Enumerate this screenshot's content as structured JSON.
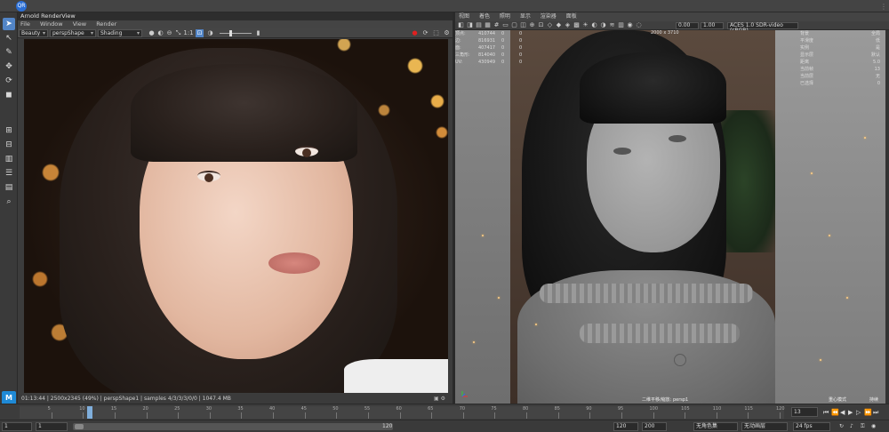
{
  "topbar": {
    "badge": "QR"
  },
  "render_view": {
    "title": "Arnold RenderView",
    "menu": [
      "File",
      "Window",
      "View",
      "Render"
    ],
    "aov_select": "Beauty",
    "camera_select": "perspShape",
    "shading_select": "Shading",
    "zoom_label": "1:1",
    "status": "01:13:44  |  2500x2345 (49%)  |  perspShape1  |  samples 4/3/3/3/0/0  |  1047.4 MB"
  },
  "viewport": {
    "menu": [
      "视图",
      "着色",
      "照明",
      "显示",
      "渲染器",
      "面板"
    ],
    "gamma_value": "0.00",
    "exposure_value": "1.00",
    "color_space": "ACES 1.0 SDR-video (sRGB)",
    "resolution": "2000 x 3710",
    "hud_left": [
      [
        "顶点:",
        "410744",
        "0",
        "0"
      ],
      [
        "边:",
        "816931",
        "0",
        "0"
      ],
      [
        "面:",
        "407417",
        "0",
        "0"
      ],
      [
        "三角形:",
        "814040",
        "0",
        "0"
      ],
      [
        "UV:",
        "430949",
        "0",
        "0"
      ]
    ],
    "hud_right": [
      [
        "背景",
        "全局"
      ],
      [
        "平滑度",
        "低"
      ],
      [
        "实例",
        "是"
      ],
      [
        "显示层",
        "默认"
      ],
      [
        "距离",
        "5.0"
      ],
      [
        "当前帧",
        "13"
      ],
      [
        "当前层",
        "无"
      ],
      [
        "已选择",
        "0"
      ]
    ],
    "camera_label": "二维平移/缩放: persp1",
    "corner_left": "重心模式",
    "corner_right": "持续"
  },
  "timeline": {
    "current_frame": "13",
    "tick_labels": [
      "5",
      "10",
      "15",
      "20",
      "25",
      "30",
      "35",
      "40",
      "45",
      "50",
      "55",
      "60",
      "65",
      "70",
      "75",
      "80",
      "85",
      "90",
      "95",
      "100",
      "105",
      "110",
      "115",
      "120"
    ]
  },
  "range": {
    "start": "1",
    "inner_start": "1",
    "inner_end": "120",
    "end_a": "120",
    "end_b": "200",
    "no_char_set": "无角色集",
    "no_anim_layer": "无动画层",
    "fps": "24 fps"
  }
}
